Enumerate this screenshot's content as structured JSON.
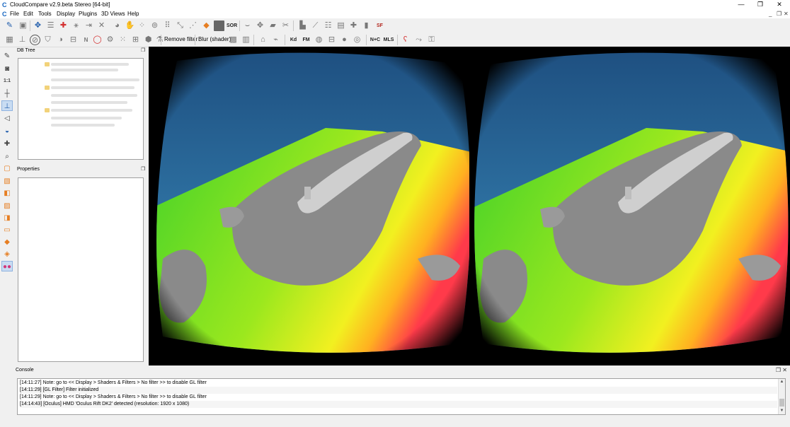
{
  "window": {
    "title": "CloudCompare v2.9.beta Stereo [64-bit]",
    "app_icon": "C",
    "minimize": "—",
    "restore": "❐",
    "close": "✕"
  },
  "menu": {
    "items": [
      "File",
      "Edit",
      "Tools",
      "Display",
      "Plugins",
      "3D Views",
      "Help"
    ],
    "mdi_minimize": "_",
    "mdi_restore": "❐",
    "mdi_close": "✕"
  },
  "toolbar2": {
    "remove_filter": "Remove filter",
    "blur_shader": "Blur (shader)",
    "kd_label": "Kd",
    "fm_label": "FM",
    "nc_label": "N+C",
    "mls_label": "MLS"
  },
  "toolbar1": {
    "sor_label": "SOR",
    "sf_label": "SF"
  },
  "left_toolbar": {
    "onetoone": "1:1"
  },
  "db_tree": {
    "title": "DB Tree",
    "float_icon": "❐"
  },
  "properties": {
    "title": "Properties",
    "float_icon": "❐"
  },
  "console": {
    "title": "Console",
    "float_icon": "❐",
    "close_icon": "✕",
    "lines": [
      "[14:11:27] Note: go to << Display > Shaders & Filters > No filter >> to disable GL filter",
      "[14:11:29] [GL Filter] Filter initialized",
      "[14:11:29] Note: go to << Display > Shaders & Filters > No filter >> to disable GL filter",
      "[14:14:43] [Oculus] HMD 'Oculus Rift DK2' detected (resolution: 1920 x 1080)"
    ]
  },
  "colors": {
    "sky_top": "#1e4f80",
    "sky_bottom": "#3b8fbf",
    "ground_green": "#41d12a",
    "ground_yellow": "#c7f020",
    "ground_red": "#ff3a4a",
    "structure_gray": "#8a8a8a"
  }
}
